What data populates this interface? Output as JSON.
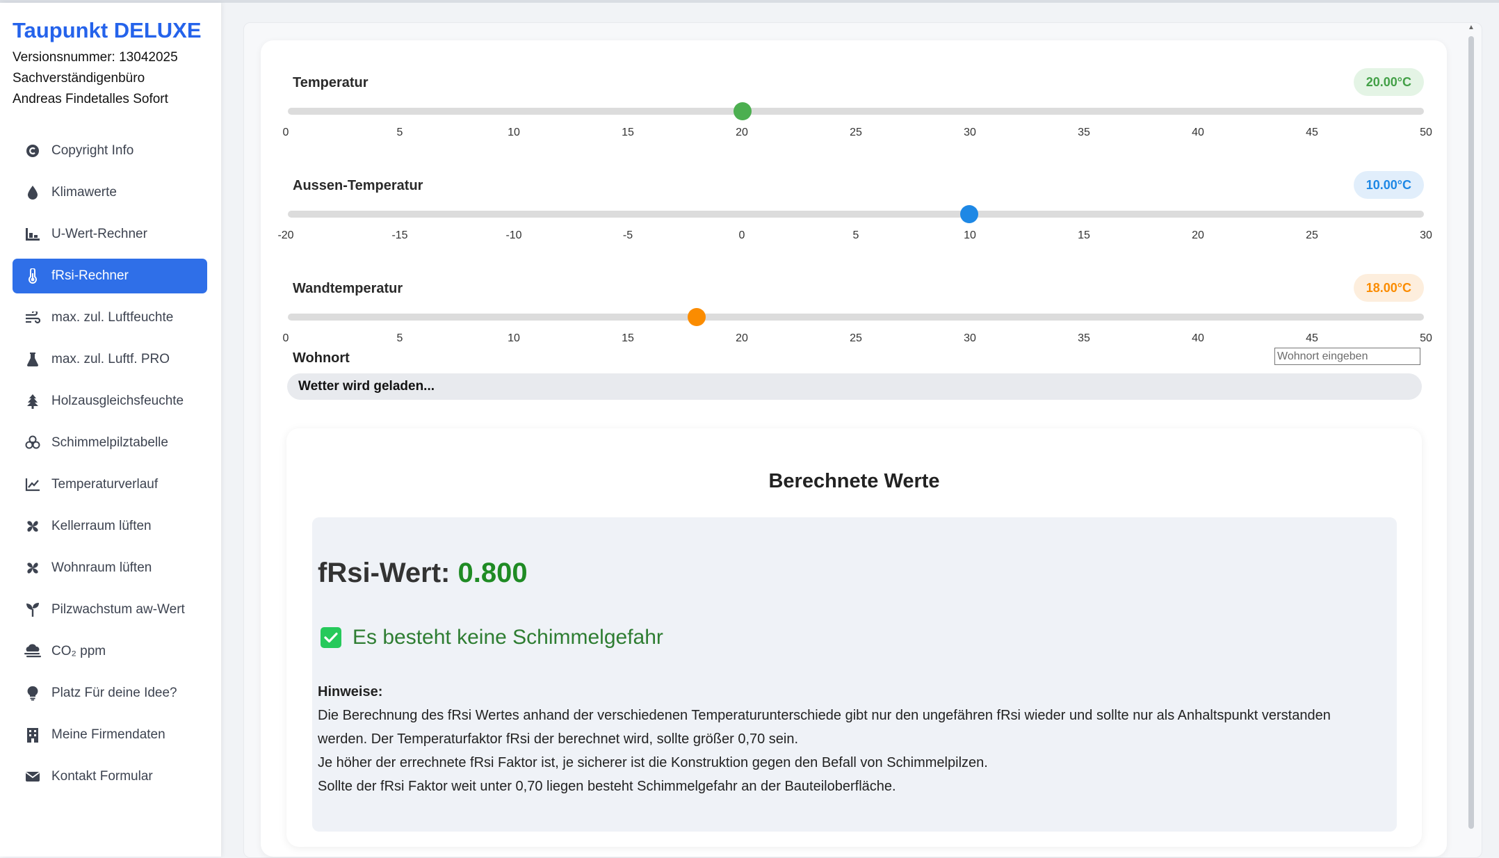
{
  "app": {
    "title": "Taupunkt DELUXE",
    "version_line": "Versionsnummer: 13042025",
    "company_line1": "Sachverständigenbüro",
    "company_line2": "Andreas Findetalles Sofort"
  },
  "sidebar": {
    "items": [
      {
        "label": "Copyright Info",
        "icon": "copyright-icon"
      },
      {
        "label": "Klimawerte",
        "icon": "droplet-icon"
      },
      {
        "label": "U-Wert-Rechner",
        "icon": "chart-bars-icon"
      },
      {
        "label": "fRsi-Rechner",
        "icon": "thermometer-icon",
        "active": true
      },
      {
        "label": "max. zul. Luftfeuchte",
        "icon": "wind-icon"
      },
      {
        "label": "max. zul. Luftf. PRO",
        "icon": "flask-icon"
      },
      {
        "label": "Holzausgleichsfeuchte",
        "icon": "tree-icon"
      },
      {
        "label": "Schimmelpilztabelle",
        "icon": "biohazard-icon"
      },
      {
        "label": "Temperaturverlauf",
        "icon": "line-chart-icon"
      },
      {
        "label": "Kellerraum lüften",
        "icon": "fan-icon"
      },
      {
        "label": "Wohnraum lüften",
        "icon": "fan-icon"
      },
      {
        "label": "Pilzwachstum aw-Wert",
        "icon": "seedling-icon"
      },
      {
        "label": "CO₂ ppm",
        "icon": "smog-icon"
      },
      {
        "label": "Platz Für deine Idee?",
        "icon": "lightbulb-icon"
      },
      {
        "label": "Meine Firmendaten",
        "icon": "building-icon"
      },
      {
        "label": "Kontakt Formular",
        "icon": "envelope-icon"
      }
    ]
  },
  "sliders": [
    {
      "label": "Temperatur",
      "value_text": "20.00°C",
      "min": 0,
      "max": 50,
      "value": 20,
      "color": "#4caf50",
      "ticks": [
        "0",
        "5",
        "10",
        "15",
        "20",
        "25",
        "30",
        "35",
        "40",
        "45",
        "50"
      ]
    },
    {
      "label": "Aussen-Temperatur",
      "value_text": "10.00°C",
      "min": -20,
      "max": 30,
      "value": 10,
      "color": "#1e88e5",
      "ticks": [
        "-20",
        "-15",
        "-10",
        "-5",
        "0",
        "5",
        "10",
        "15",
        "20",
        "25",
        "30"
      ]
    },
    {
      "label": "Wandtemperatur",
      "value_text": "18.00°C",
      "min": 0,
      "max": 50,
      "value": 18,
      "color": "#fb8c00",
      "ticks": [
        "0",
        "5",
        "10",
        "15",
        "20",
        "25",
        "30",
        "35",
        "40",
        "45",
        "50"
      ]
    }
  ],
  "wohnort": {
    "label": "Wohnort",
    "placeholder": "Wohnort eingeben",
    "weather_status": "Wetter wird geladen..."
  },
  "results": {
    "title": "Berechnete Werte",
    "frsi_label": "fRsi-Wert:",
    "frsi_value": "0.800",
    "status": "Es besteht keine Schimmelgefahr",
    "notes_head": "Hinweise:",
    "notes": [
      "Die Berechnung des fRsi Wertes anhand der verschiedenen Temperaturunterschiede gibt nur den ungefähren fRsi wieder und sollte nur als Anhaltspunkt verstanden werden. Der Temperaturfaktor fRsi der berechnet wird, sollte größer 0,70 sein.",
      "Je höher der errechnete fRsi Faktor ist, je sicherer ist die Konstruktion gegen den Befall von Schimmelpilzen.",
      "Sollte der fRsi Faktor weit unter 0,70 liegen besteht Schimmelgefahr an der Bauteiloberfläche."
    ]
  }
}
